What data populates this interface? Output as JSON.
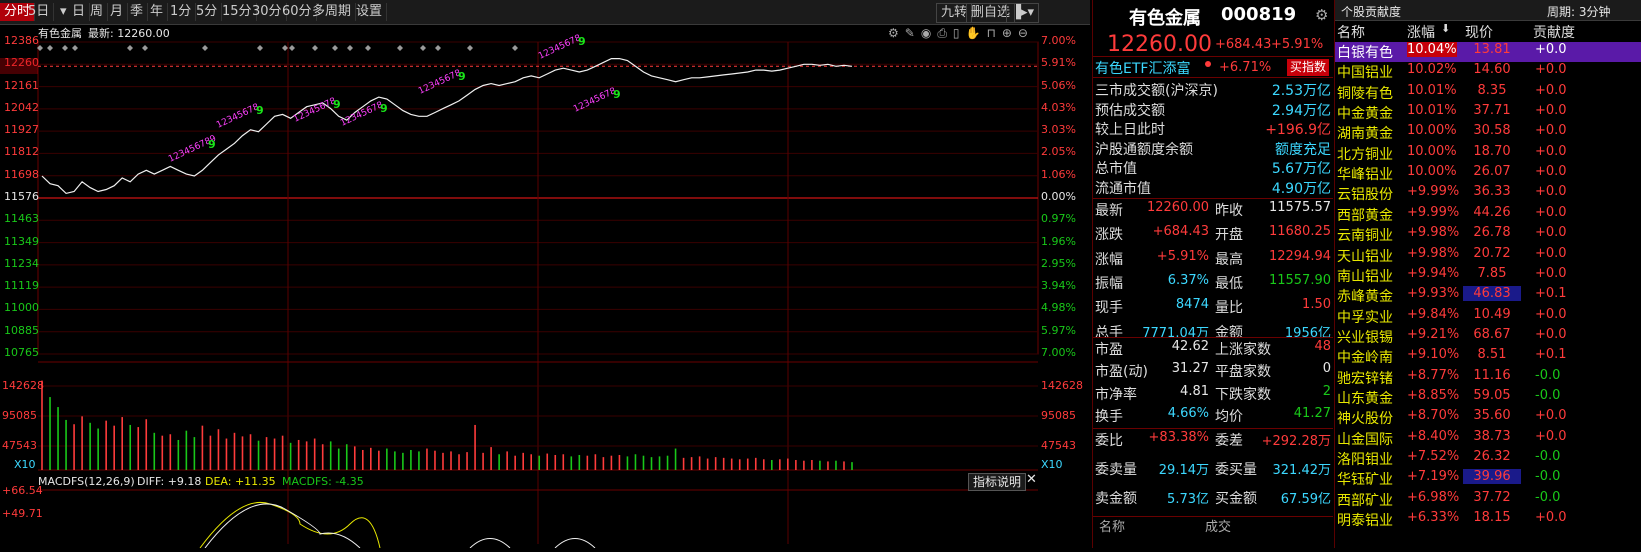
{
  "toolbar": {
    "tabs": [
      "分时",
      "5日",
      "日",
      "周",
      "月",
      "季",
      "年",
      "1分",
      "5分",
      "15分",
      "30分",
      "60分",
      "多周期",
      "设置"
    ],
    "active_tab": "分时",
    "right_buttons": [
      "九转",
      "删自选"
    ]
  },
  "chart": {
    "title": "有色金属",
    "latest_label": "最新: 12260.00",
    "y_price_ticks": [
      "12386",
      "12260",
      "12161",
      "12042",
      "11927",
      "11812",
      "11698",
      "11576",
      "11463",
      "11349",
      "11234",
      "11119",
      "11000",
      "10885",
      "10765"
    ],
    "y_pct_right": [
      "7.00%",
      "5.91%",
      "5.06%",
      "4.03%",
      "3.03%",
      "2.05%",
      "1.06%",
      "0.00%",
      "0.97%",
      "1.96%",
      "2.95%",
      "3.94%",
      "4.98%",
      "5.97%",
      "7.00%"
    ],
    "vol_ticks": [
      "142628",
      "95085",
      "47543"
    ],
    "vol_unit": "X10",
    "macd_title": "MACDFS(12,26,9)",
    "diff_label": "DIFF: +9.18",
    "dea_label": "DEA: +11.35",
    "macdfs_label": "MACDFS: -4.35",
    "macd_ticks": [
      "+66.54",
      "+49.71"
    ],
    "indicator_btn": "指标说明",
    "nine_turn": [
      {
        "seq": "123456789",
        "pos": "a"
      },
      {
        "seq": "12345678",
        "pos": "b"
      },
      {
        "seq": "12345678",
        "pos": "c"
      },
      {
        "seq": "12345678",
        "pos": "d"
      },
      {
        "seq": "12345678",
        "pos": "e"
      },
      {
        "seq": "12345678",
        "pos": "f"
      },
      {
        "seq": "12345678",
        "pos": "g"
      }
    ],
    "nine_suffix": "9"
  },
  "chart_data": {
    "type": "line",
    "title": "",
    "xlabel": "",
    "ylabel": "",
    "ylim": [
      10765,
      12386
    ],
    "prev_close": 11575.57,
    "series": [
      {
        "name": "有色金属",
        "values": [
          11690,
          11650,
          11640,
          11600,
          11610,
          11660,
          11630,
          11610,
          11620,
          11640,
          11680,
          11660,
          11700,
          11720,
          11700,
          11720,
          11740,
          11720,
          11700,
          11690,
          11720,
          11760,
          11800,
          11830,
          11860,
          11900,
          11930,
          11920,
          11960,
          12000,
          12010,
          11990,
          12020,
          12050,
          12060,
          12070,
          12040,
          12000,
          11980,
          12020,
          12050,
          12080,
          12100,
          12090,
          12060,
          12030,
          12010,
          12000,
          12000,
          12020,
          12040,
          12060,
          12080,
          12110,
          12140,
          12160,
          12170,
          12160,
          12170,
          12180,
          12200,
          12210,
          12200,
          12220,
          12240,
          12250,
          12240,
          12230,
          12240,
          12260,
          12280,
          12300,
          12300,
          12290,
          12260,
          12230,
          12210,
          12200,
          12190,
          12180,
          12190,
          12200,
          12200,
          12205,
          12210,
          12215,
          12220,
          12225,
          12230,
          12240,
          12240,
          12235,
          12240,
          12250,
          12260,
          12270,
          12270,
          12265,
          12270,
          12260,
          12265,
          12260
        ]
      }
    ],
    "volume_max": 142628,
    "volumes": [
      125000,
      102000,
      88000,
      70000,
      64000,
      75000,
      66000,
      58000,
      69000,
      62000,
      74000,
      63000,
      60000,
      71000,
      52000,
      48000,
      50000,
      42000,
      55000,
      46000,
      62000,
      48000,
      57000,
      44000,
      52000,
      47000,
      50000,
      41000,
      46000,
      44000,
      48000,
      38000,
      42000,
      40000,
      44000,
      36000,
      40000,
      30000,
      36000,
      33000,
      28000,
      31000,
      27000,
      30000,
      26000,
      24000,
      28000,
      26000,
      30000,
      27000,
      24000,
      26000,
      22000,
      25000,
      63000,
      24000,
      32000,
      22000,
      26000,
      20000,
      24000,
      22000,
      20000,
      23000,
      21000,
      22000,
      19000,
      21000,
      20000,
      22000,
      18000,
      20000,
      21000,
      19000,
      22000,
      20000,
      18000,
      19000,
      20000,
      30000,
      17000,
      18000,
      19000,
      16000,
      18000,
      17000,
      16000,
      15000,
      16000,
      17000,
      15000,
      14000,
      15000,
      16000,
      14000,
      13000,
      14000,
      13000,
      12000,
      13000,
      12000,
      11000
    ]
  },
  "quote": {
    "name": "有色金属",
    "code": "000819",
    "price": "12260.00",
    "change": "+684.43",
    "change_pct": "+5.91%",
    "etf_name": "有色ETF汇添富",
    "etf_pct": "+6.71%",
    "etf_btn": "买指数",
    "stats": [
      {
        "label": "三市成交额(沪深京)",
        "value": "2.53",
        "unit": "万亿",
        "color": "cyan"
      },
      {
        "label": "预估成交额",
        "value": "2.94",
        "unit": "万亿",
        "color": "cyan"
      },
      {
        "label": "较上日此时",
        "value": "+196.9",
        "unit": "亿",
        "color": "red"
      },
      {
        "label": "沪股通额度余额",
        "value": "额度充足",
        "unit": "",
        "color": "cyan"
      },
      {
        "label": "总市值",
        "value": "5.67",
        "unit": "万亿",
        "color": "cyan"
      },
      {
        "label": "流通市值",
        "value": "4.90",
        "unit": "万亿",
        "color": "cyan"
      }
    ],
    "grid": [
      {
        "l1": "最新",
        "v1": "12260.00",
        "c1": "red",
        "l2": "昨收",
        "v2": "11575.57",
        "c2": "wht"
      },
      {
        "l1": "涨跌",
        "v1": "+684.43",
        "c1": "red",
        "l2": "开盘",
        "v2": "11680.25",
        "c2": "red"
      },
      {
        "l1": "涨幅",
        "v1": "+5.91%",
        "c1": "red",
        "l2": "最高",
        "v2": "12294.94",
        "c2": "red"
      },
      {
        "l1": "振幅",
        "v1": "6.37%",
        "c1": "cyan",
        "l2": "最低",
        "v2": "11557.90",
        "c2": "grn"
      },
      {
        "l1": "现手",
        "v1": "8474",
        "c1": "cyan",
        "l2": "量比",
        "v2": "1.50",
        "c2": "red"
      },
      {
        "l1": "总手",
        "v1": "7771.04万",
        "c1": "cyan",
        "l2": "金额",
        "v2": "1956亿",
        "c2": "cyan"
      }
    ],
    "grid2": [
      {
        "l1": "市盈",
        "v1": "42.62",
        "c1": "wht",
        "l2": "上涨家数",
        "v2": "48",
        "c2": "red"
      },
      {
        "l1": "市盈(动)",
        "v1": "31.27",
        "c1": "wht",
        "l2": "平盘家数",
        "v2": "0",
        "c2": "wht"
      },
      {
        "l1": "市净率",
        "v1": "4.81",
        "c1": "wht",
        "l2": "下跌家数",
        "v2": "2",
        "c2": "grn"
      },
      {
        "l1": "换手",
        "v1": "4.66%",
        "c1": "cyan",
        "l2": "均价",
        "v2": "41.27",
        "c2": "grn"
      }
    ],
    "grid3": [
      {
        "l1": "委比",
        "v1": "+83.38%",
        "c1": "red",
        "l2": "委差",
        "v2": "+292.28万",
        "c2": "red"
      },
      {
        "l1": "委卖量",
        "v1": "29.14万",
        "c1": "cyan",
        "l2": "委买量",
        "v2": "321.42万",
        "c2": "cyan"
      },
      {
        "l1": "卖金额",
        "v1": "5.73亿",
        "c1": "cyan",
        "l2": "买金额",
        "v2": "67.59亿",
        "c2": "cyan"
      }
    ],
    "bottom_labels": [
      "名称",
      "成交"
    ]
  },
  "rank": {
    "header_left": "个股贡献度",
    "header_right": "周期: 3分钟",
    "cols": [
      "名称",
      "涨幅",
      "现价",
      "贡献度"
    ],
    "rows": [
      {
        "name": "白银有色",
        "pct": "10.04%",
        "price": "13.81",
        "con": "+0.0",
        "sel": true
      },
      {
        "name": "中国铝业",
        "pct": "10.02%",
        "price": "14.60",
        "con": "+0.0"
      },
      {
        "name": "铜陵有色",
        "pct": "10.01%",
        "price": "8.35",
        "con": "+0.0"
      },
      {
        "name": "中金黄金",
        "pct": "10.01%",
        "price": "37.71",
        "con": "+0.0"
      },
      {
        "name": "湖南黄金",
        "pct": "10.00%",
        "price": "30.58",
        "con": "+0.0"
      },
      {
        "name": "北方铜业",
        "pct": "10.00%",
        "price": "18.70",
        "con": "+0.0"
      },
      {
        "name": "华峰铝业",
        "pct": "10.00%",
        "price": "26.07",
        "con": "+0.0"
      },
      {
        "name": "云铝股份",
        "pct": "+9.99%",
        "price": "36.33",
        "con": "+0.0"
      },
      {
        "name": "西部黄金",
        "pct": "+9.99%",
        "price": "44.26",
        "con": "+0.0"
      },
      {
        "name": "云南铜业",
        "pct": "+9.98%",
        "price": "26.78",
        "con": "+0.0"
      },
      {
        "name": "天山铝业",
        "pct": "+9.98%",
        "price": "20.72",
        "con": "+0.0"
      },
      {
        "name": "南山铝业",
        "pct": "+9.94%",
        "price": "7.85",
        "con": "+0.0"
      },
      {
        "name": "赤峰黄金",
        "pct": "+9.93%",
        "price": "46.83",
        "con": "+0.1",
        "hl": true
      },
      {
        "name": "中孚实业",
        "pct": "+9.84%",
        "price": "10.49",
        "con": "+0.0"
      },
      {
        "name": "兴业银锡",
        "pct": "+9.21%",
        "price": "68.67",
        "con": "+0.0"
      },
      {
        "name": "中金岭南",
        "pct": "+9.10%",
        "price": "8.51",
        "con": "+0.1"
      },
      {
        "name": "驰宏锌锗",
        "pct": "+8.77%",
        "price": "11.16",
        "con": "-0.0",
        "neg": true
      },
      {
        "name": "山东黄金",
        "pct": "+8.85%",
        "price": "59.05",
        "con": "-0.0",
        "neg": true
      },
      {
        "name": "神火股份",
        "pct": "+8.70%",
        "price": "35.60",
        "con": "+0.0"
      },
      {
        "name": "山金国际",
        "pct": "+8.40%",
        "price": "38.73",
        "con": "+0.0"
      },
      {
        "name": "洛阳钼业",
        "pct": "+7.52%",
        "price": "26.32",
        "con": "-0.0",
        "neg": true
      },
      {
        "name": "华钰矿业",
        "pct": "+7.19%",
        "price": "39.96",
        "con": "-0.0",
        "neg": true,
        "hl": true
      },
      {
        "name": "西部矿业",
        "pct": "+6.98%",
        "price": "37.72",
        "con": "-0.0",
        "neg": true
      },
      {
        "name": "明泰铝业",
        "pct": "+6.33%",
        "price": "18.15",
        "con": "+0.0"
      }
    ]
  }
}
